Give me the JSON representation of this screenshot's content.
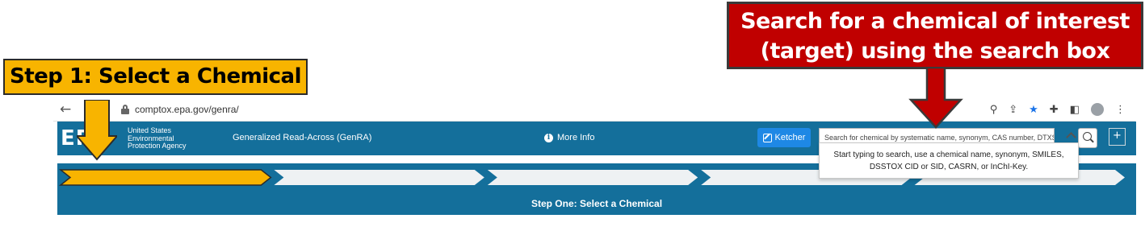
{
  "browser": {
    "url": "comptox.epa.gov/genra/",
    "back_label": "←"
  },
  "header": {
    "logo": "EPA",
    "agency_name": "United States Environmental Protection Agency",
    "app_title": "Generalized Read-Across (GenRA)",
    "more_info_label": "More Info",
    "ketcher_label": "Ketcher",
    "search_placeholder": "Search for chemical by systematic name, synonym, CAS number, DTXSID or InChIKey",
    "expand_label": "+"
  },
  "search_dropdown": {
    "line1": "Start typing to search, use a chemical name, synonym, SMILES,",
    "line2": "DSSTOX CID or SID, CASRN, or InChI-Key."
  },
  "steps": {
    "count": 5,
    "active_index": 0,
    "active_color": "#f8b400",
    "inactive_color": "#eef1f3",
    "current_step_title": "Step One: Select a Chemical"
  },
  "annotations": {
    "step_callout": "Step 1: Select a Chemical",
    "search_callout_line1": "Search for a chemical of interest",
    "search_callout_line2": "(target) using the search box",
    "step_callout_color": "#f8b400",
    "search_callout_color": "#c00000"
  },
  "colors": {
    "header_bg": "#146f9b",
    "ketcher_bg": "#1e88e5"
  }
}
